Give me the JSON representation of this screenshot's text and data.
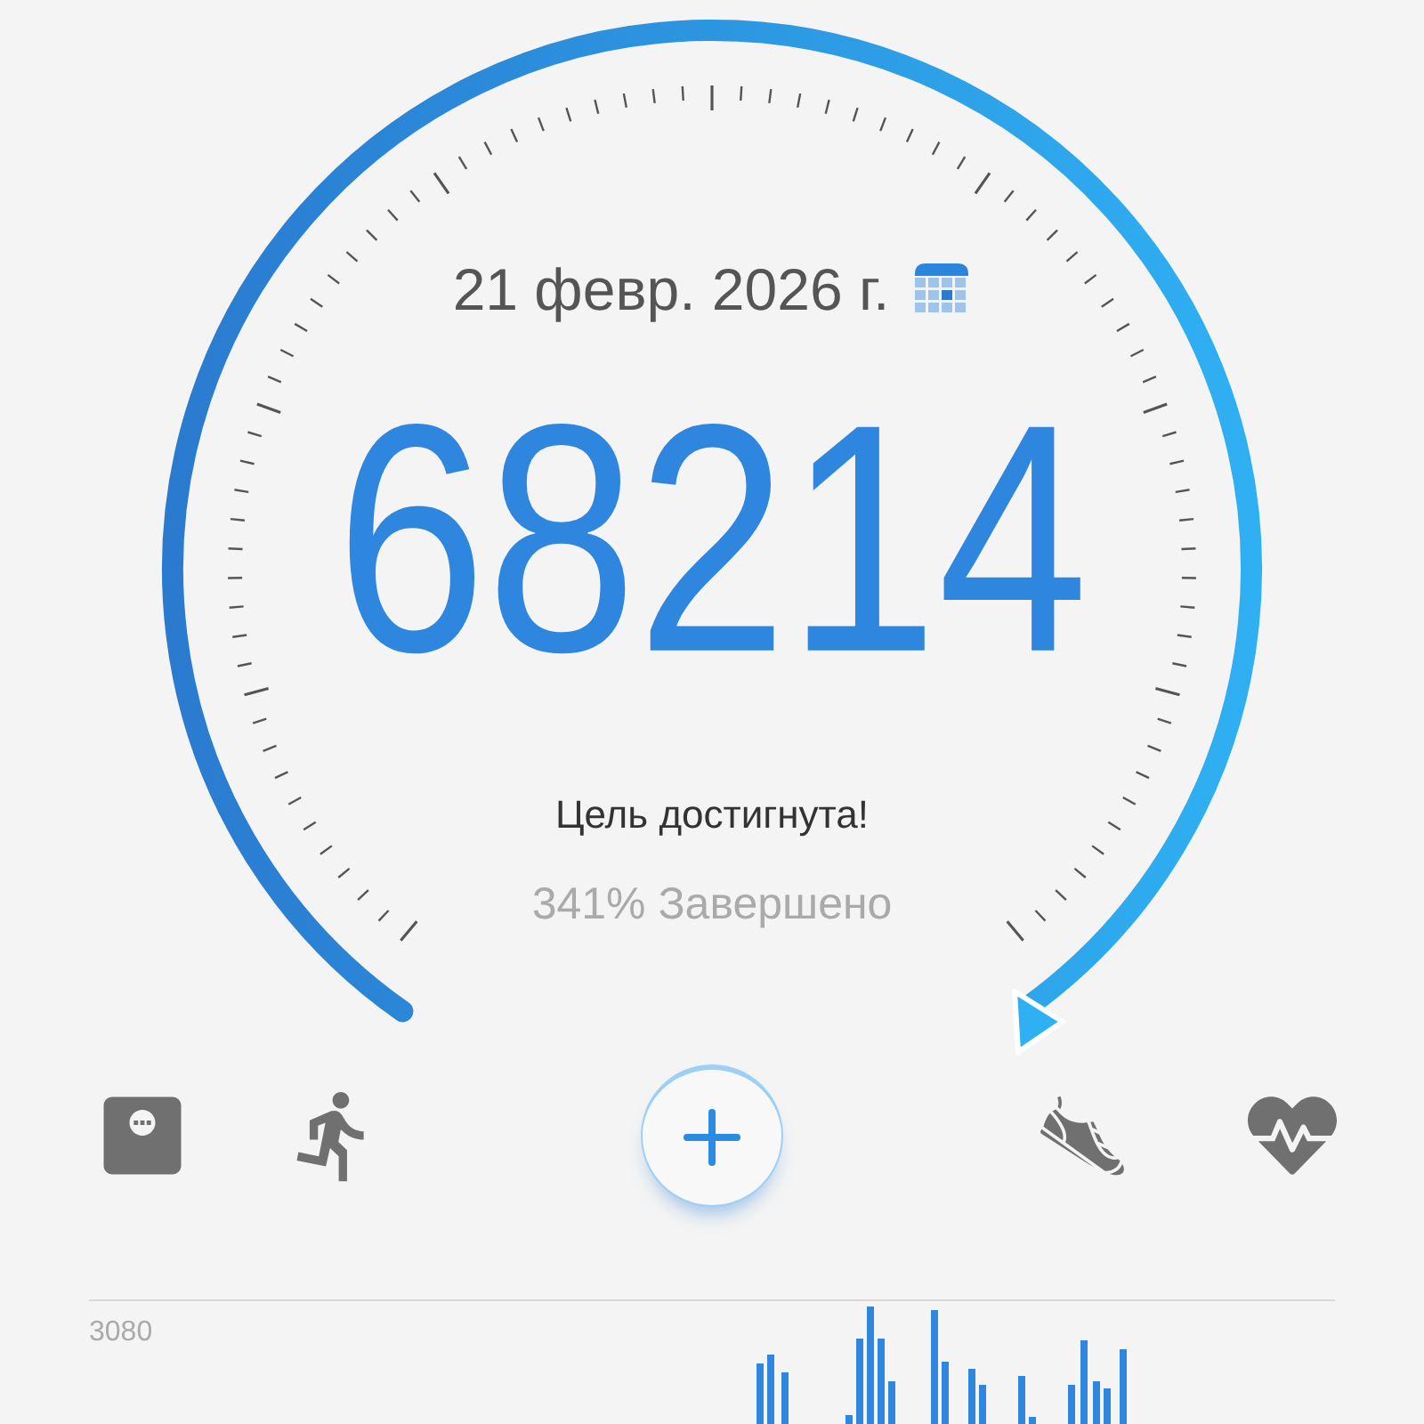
{
  "date": "21 февр. 2026 г.",
  "steps": "68214",
  "goal_status": "Цель достигнута!",
  "completion": "341% Завершено",
  "chart": {
    "max_label": "3080"
  }
}
